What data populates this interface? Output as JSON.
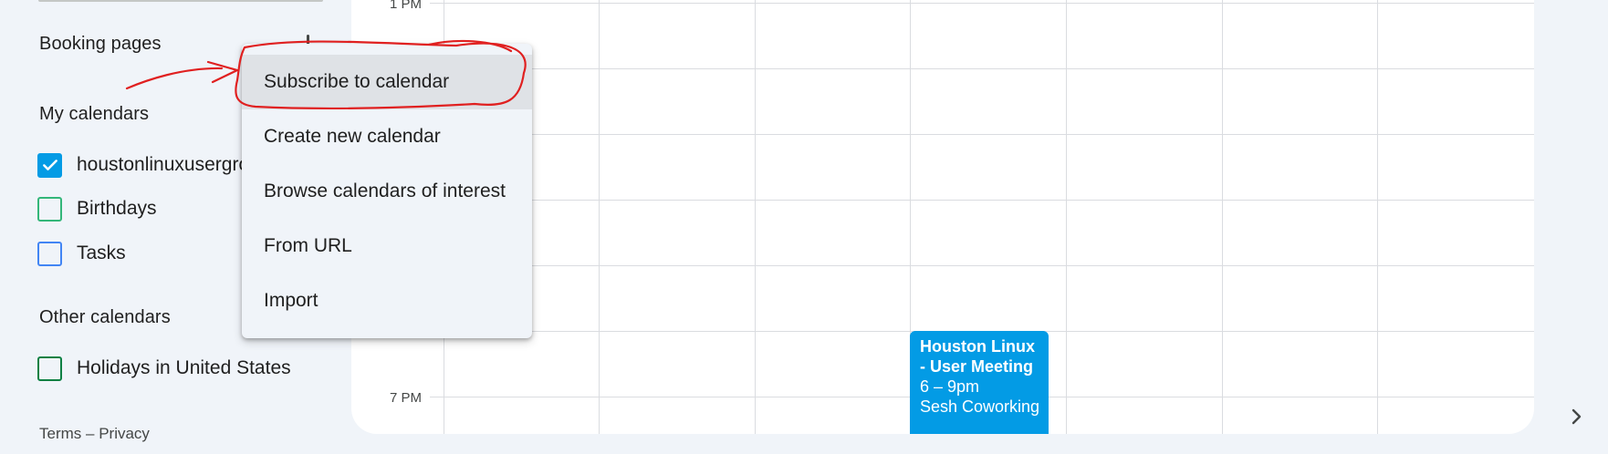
{
  "sidebar": {
    "booking_pages_title": "Booking pages",
    "my_calendars_title": "My calendars",
    "my_calendars": [
      {
        "label": "houstonlinuxusergroup",
        "checked": true,
        "color": "#039be5"
      },
      {
        "label": "Birthdays",
        "checked": false,
        "color": "#33b679"
      },
      {
        "label": "Tasks",
        "checked": false,
        "color": "#4285f4"
      }
    ],
    "other_calendars_title": "Other calendars",
    "other_calendars": [
      {
        "label": "Holidays in United States",
        "checked": false,
        "color": "#0b8043"
      }
    ],
    "footer": {
      "terms": "Terms",
      "separator": " – ",
      "privacy": "Privacy"
    }
  },
  "calendar": {
    "time_labels": [
      "1 PM",
      "7 PM"
    ],
    "event": {
      "title": "Houston Linux - User Meeting",
      "time": "6 – 9pm",
      "location": "Sesh Coworking",
      "color": "#039be5"
    }
  },
  "menu": {
    "items": [
      {
        "label": "Subscribe to calendar",
        "highlighted": true
      },
      {
        "label": "Create new calendar",
        "highlighted": false
      },
      {
        "label": "Browse calendars of interest",
        "highlighted": false
      },
      {
        "label": "From URL",
        "highlighted": false
      },
      {
        "label": "Import",
        "highlighted": false
      }
    ]
  },
  "annotation": {
    "color": "#e02020"
  }
}
